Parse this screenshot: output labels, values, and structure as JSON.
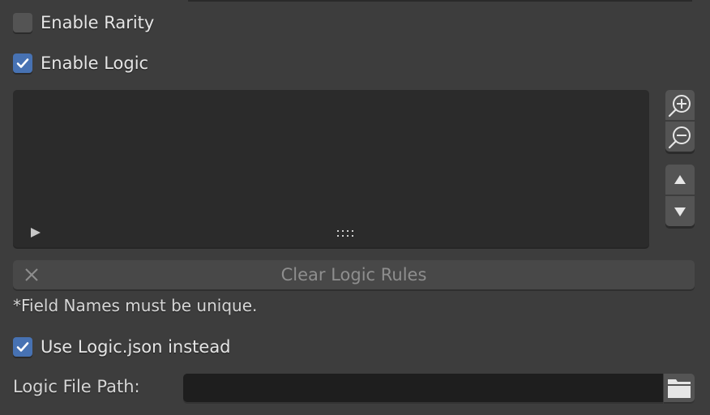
{
  "panel": {
    "enable_rarity": {
      "label": "Enable Rarity",
      "checked": false
    },
    "enable_logic": {
      "label": "Enable Logic",
      "checked": true
    },
    "logic_list": {
      "items": [],
      "expand_icon": "play-triangle-icon",
      "resize_grip_icon": "grip-dots-icon"
    },
    "side_buttons": {
      "add": {
        "icon": "zoom-in-icon",
        "tooltip": "Add"
      },
      "remove": {
        "icon": "zoom-out-icon",
        "tooltip": "Remove"
      },
      "move_up": {
        "icon": "triangle-up-icon"
      },
      "move_down": {
        "icon": "triangle-down-icon"
      }
    },
    "clear_button": {
      "label": "Clear Logic Rules",
      "icon": "x-icon"
    },
    "note": "*Field Names must be unique.",
    "use_logic_json": {
      "label": "Use Logic.json instead",
      "checked": true
    },
    "logic_file_path": {
      "label": "Logic File Path:",
      "value": "",
      "icon": "folder-icon"
    }
  },
  "colors": {
    "accent": "#4772b3",
    "background": "#3d3d3d",
    "list_background": "#2b2b2b",
    "input_background": "#1e1e1e",
    "button_background": "#545454"
  }
}
